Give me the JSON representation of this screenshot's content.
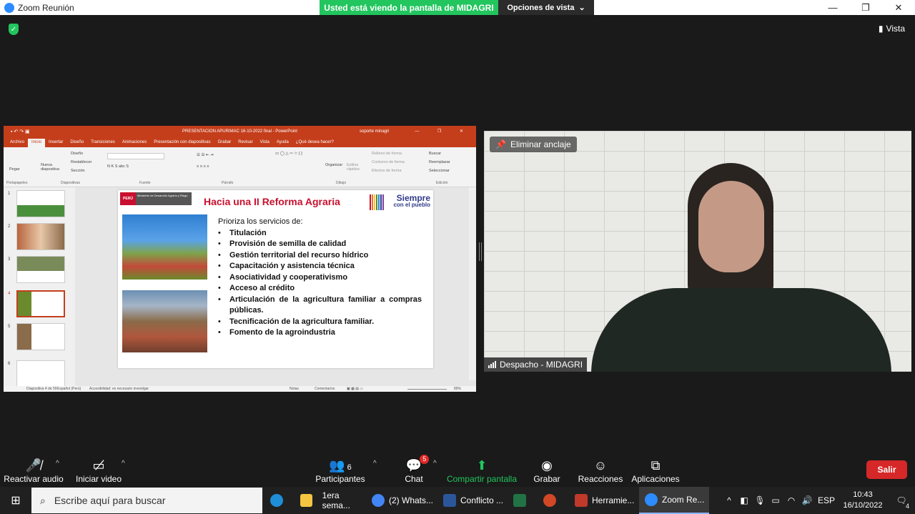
{
  "window": {
    "title": "Zoom Reunión",
    "sharing_banner": "Usted está viendo la pantalla de MIDAGRI",
    "view_options": "Opciones de vista",
    "view_button": "Vista"
  },
  "ppt": {
    "doc_title": "PRESENTACION APURIMAC 16-10-2022 final  -  PowerPoint",
    "user": "soporte minagri",
    "tabs": [
      "Archivo",
      "Inicio",
      "Insertar",
      "Diseño",
      "Transiciones",
      "Animaciones",
      "Presentación con diapositivas",
      "Grabar",
      "Revisar",
      "Vista",
      "Ayuda",
      "¿Qué desea hacer?"
    ],
    "ribbon": {
      "paste": "Pegar",
      "new_slide": "Nueva diapositiva",
      "design": "Diseño",
      "reset": "Restablecer",
      "section": "Sección",
      "organize": "Organizar",
      "quick_styles": "Estilos rápidos",
      "fill": "Relleno de forma",
      "outline": "Contorno de forma",
      "effects": "Efectos de forma",
      "find": "Buscar",
      "replace": "Reemplazar",
      "select": "Seleccionar",
      "groups": [
        "Portapapeles",
        "Diapositivas",
        "Fuente",
        "Párrafo",
        "Dibujo",
        "Edición"
      ]
    },
    "thumb_numbers": [
      "1",
      "2",
      "3",
      "4",
      "5",
      "6"
    ],
    "slide": {
      "gov_label": "PERÚ",
      "ministry": "Ministerio de Desarrollo Agrario y Riego",
      "title": "Hacia una II Reforma Agraria",
      "brand_main": "Siempre",
      "brand_sub": "con el pueblo",
      "intro": "Prioriza los servicios de:",
      "bullets": [
        "Titulación",
        "Provisión de semilla de calidad",
        "Gestión territorial del recurso hídrico",
        "Capacitación y asistencia técnica",
        "Asociatividad y cooperativismo",
        "Acceso al crédito",
        "Articulación de la agricultura familiar a compras públicas.",
        "Tecnificación de la agricultura familiar.",
        "Fomento de la agroindustria"
      ]
    },
    "status": {
      "slide_count": "Diapositiva 4 de 59",
      "language": "Español (Perú)",
      "accessibility": "Accesibilidad: es necesario investigar",
      "notes": "Notas",
      "comments": "Comentarios",
      "zoom": "89%"
    }
  },
  "camera": {
    "unpin": "Eliminar anclaje",
    "participant_name": "Despacho - MIDAGRI"
  },
  "toolbar": {
    "unmute": "Reactivar audio",
    "start_video": "Iniciar video",
    "participants": "Participantes",
    "participants_count": "6",
    "chat": "Chat",
    "chat_badge": "5",
    "share": "Compartir pantalla",
    "record": "Grabar",
    "reactions": "Reacciones",
    "apps": "Aplicaciones",
    "leave": "Salir"
  },
  "taskbar": {
    "search_placeholder": "Escribe aquí para buscar",
    "apps": [
      {
        "label": "1era sema...",
        "icon": "folder-icon",
        "color": "#f4c542"
      },
      {
        "label": "(2) Whats...",
        "icon": "chrome-icon",
        "color": "#4285f4"
      },
      {
        "label": "Conflicto ...",
        "icon": "word-icon",
        "color": "#2b579a"
      },
      {
        "label": "",
        "icon": "excel-icon",
        "color": "#217346"
      },
      {
        "label": "",
        "icon": "powerpoint-icon",
        "color": "#d24726"
      },
      {
        "label": "Herramie...",
        "icon": "snipping-icon",
        "color": "#c0392b"
      },
      {
        "label": "Zoom Re...",
        "icon": "zoom-icon",
        "color": "#2d8cff"
      }
    ],
    "language": "ESP",
    "time": "10:43",
    "date": "16/10/2022",
    "notifications": "4"
  },
  "colors": {
    "zoom_green": "#22c55e",
    "ppt_red": "#c43e1c",
    "slide_title": "#c8102e",
    "leave_red": "#d62828"
  }
}
